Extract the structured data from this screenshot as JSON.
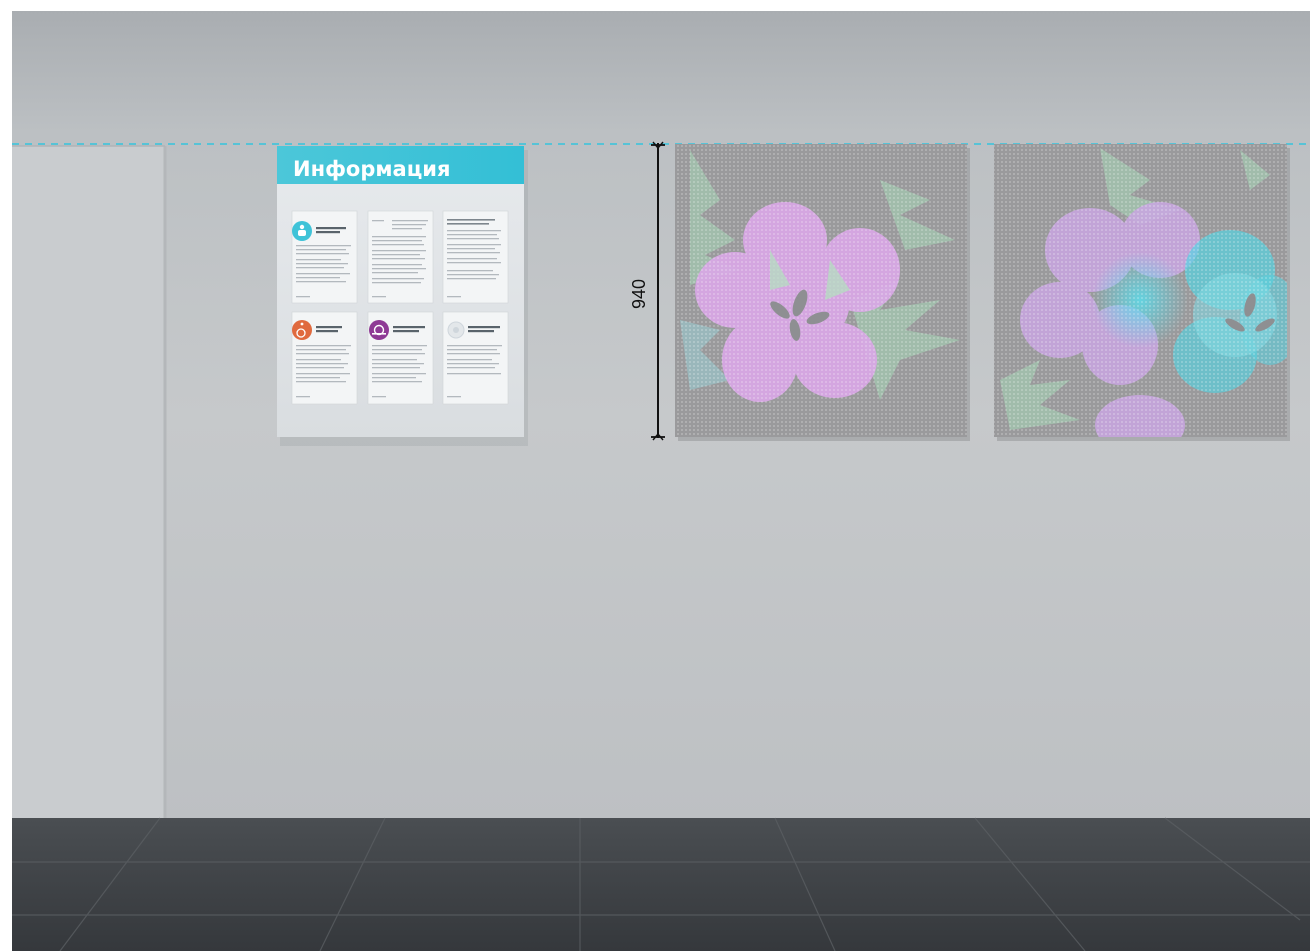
{
  "info_board": {
    "title": "Информация",
    "accent": "#3fc3d8",
    "sheets": [
      {
        "icon": "person-icon",
        "icon_color": "#3fc3d8",
        "has_heading": true
      },
      {
        "icon": null,
        "has_heading": false
      },
      {
        "icon": null,
        "has_heading": false
      },
      {
        "icon": "wheelchair-icon",
        "icon_color": "#e06a3e",
        "has_heading": true
      },
      {
        "icon": "mri-scanner-icon",
        "icon_color": "#8e3a95",
        "has_heading": true
      },
      {
        "icon": "info-icon",
        "icon_color": "#cfd6dc",
        "has_heading": true
      }
    ]
  },
  "dimension": {
    "label": "940",
    "guide_color": "#35c4dd"
  },
  "artworks": [
    {
      "name": "flower-panel-left",
      "background": "#9a9a9c",
      "petal_color": "#d9a8e6",
      "leaf_color": "#a8d8b8"
    },
    {
      "name": "flower-panel-right",
      "background": "#9a9a9c",
      "petal_color": "#c9a6e2",
      "accent_color": "#55d6e4",
      "leaf_color": "#a8d8b8"
    }
  ],
  "colors": {
    "wall": "#c3c6c9",
    "floor": "#3f4347"
  }
}
